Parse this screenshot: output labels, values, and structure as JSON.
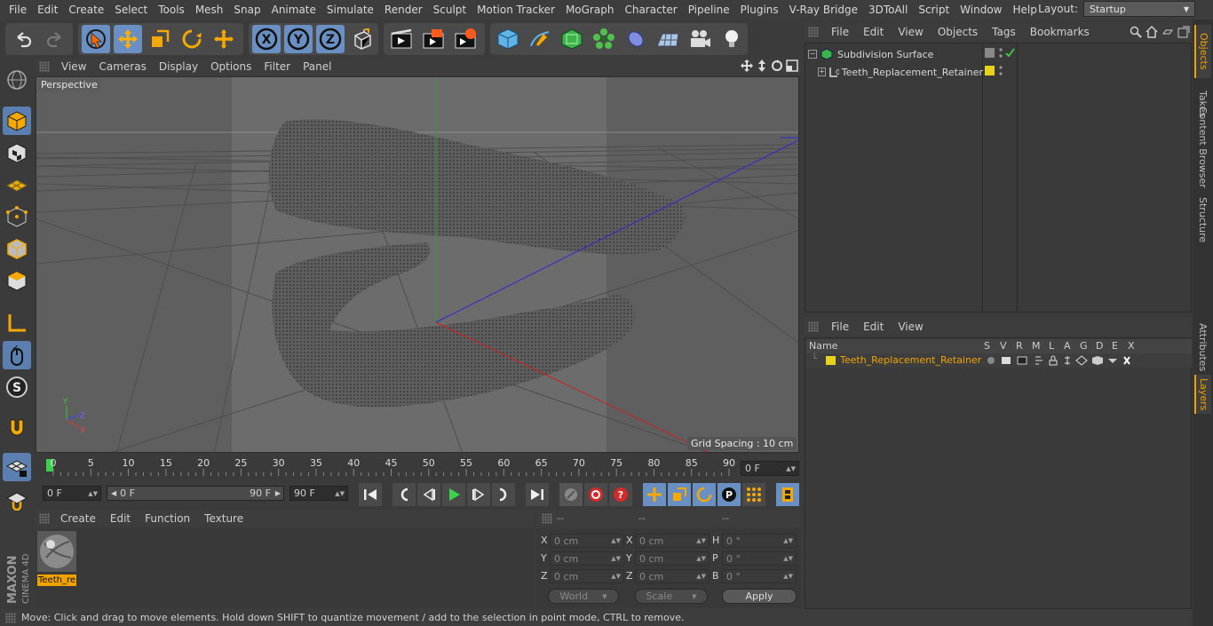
{
  "menubar": {
    "items": [
      "File",
      "Edit",
      "Create",
      "Select",
      "Tools",
      "Mesh",
      "Snap",
      "Animate",
      "Simulate",
      "Render",
      "Sculpt",
      "Motion Tracker",
      "MoGraph",
      "Character",
      "Pipeline",
      "Plugins",
      "V-Ray Bridge",
      "3DToAll",
      "Script",
      "Window",
      "Help"
    ],
    "layout_label": "Layout:",
    "layout_value": "Startup"
  },
  "viewport": {
    "menu": [
      "View",
      "Cameras",
      "Display",
      "Options",
      "Filter",
      "Panel"
    ],
    "camera_label": "Perspective",
    "grid_spacing": "Grid Spacing : 10 cm",
    "axis_x": "X",
    "axis_y": "Y",
    "axis_z": "Z"
  },
  "timeline": {
    "ticks": [
      "0",
      "5",
      "10",
      "15",
      "20",
      "25",
      "30",
      "35",
      "40",
      "45",
      "50",
      "55",
      "60",
      "65",
      "70",
      "75",
      "80",
      "85",
      "90"
    ],
    "current_frame": "0 F",
    "start_field": "0 F",
    "range_start": "0 F",
    "range_end": "90 F",
    "end_field": "90 F"
  },
  "material_manager": {
    "menu": [
      "Create",
      "Edit",
      "Function",
      "Texture"
    ],
    "material_name": "Teeth_re"
  },
  "coordinates": {
    "headers": [
      "--",
      "--",
      "--"
    ],
    "rows": [
      {
        "a_label": "X",
        "a_value": "0 cm",
        "b_label": "X",
        "b_value": "0 cm",
        "c_label": "H",
        "c_value": "0 °"
      },
      {
        "a_label": "Y",
        "a_value": "0 cm",
        "b_label": "Y",
        "b_value": "0 cm",
        "c_label": "P",
        "c_value": "0 °"
      },
      {
        "a_label": "Z",
        "a_value": "0 cm",
        "b_label": "Z",
        "b_value": "0 cm",
        "c_label": "B",
        "c_value": "0 °"
      }
    ],
    "mode_world": "World",
    "mode_scale": "Scale",
    "apply_label": "Apply"
  },
  "status_bar": {
    "text": "Move: Click and drag to move elements. Hold down SHIFT to quantize movement / add to the selection in point mode, CTRL to remove."
  },
  "objects_panel": {
    "menu": [
      "File",
      "Edit",
      "View",
      "Objects",
      "Tags",
      "Bookmarks"
    ],
    "items": [
      {
        "name": "Subdivision Surface"
      },
      {
        "name": "Teeth_Replacement_Retainer"
      }
    ]
  },
  "layers_panel": {
    "menu": [
      "File",
      "Edit",
      "View"
    ],
    "columns": [
      "Name",
      "S",
      "V",
      "R",
      "M",
      "L",
      "A",
      "G",
      "D",
      "E",
      "X"
    ],
    "layer_name": "Teeth_Replacement_Retainer",
    "layer_color": "#e8d21a"
  },
  "right_tabs": [
    "Objects",
    "Takes",
    "Content Browser",
    "Structure",
    "Attributes",
    "Layers"
  ],
  "brand": {
    "maxon": "MAXON",
    "product": "CINEMA 4D"
  },
  "colors": {
    "accent_blue": "#6a8fc2",
    "accent_orange": "#f0a300",
    "layer_yellow": "#e8d21a"
  }
}
